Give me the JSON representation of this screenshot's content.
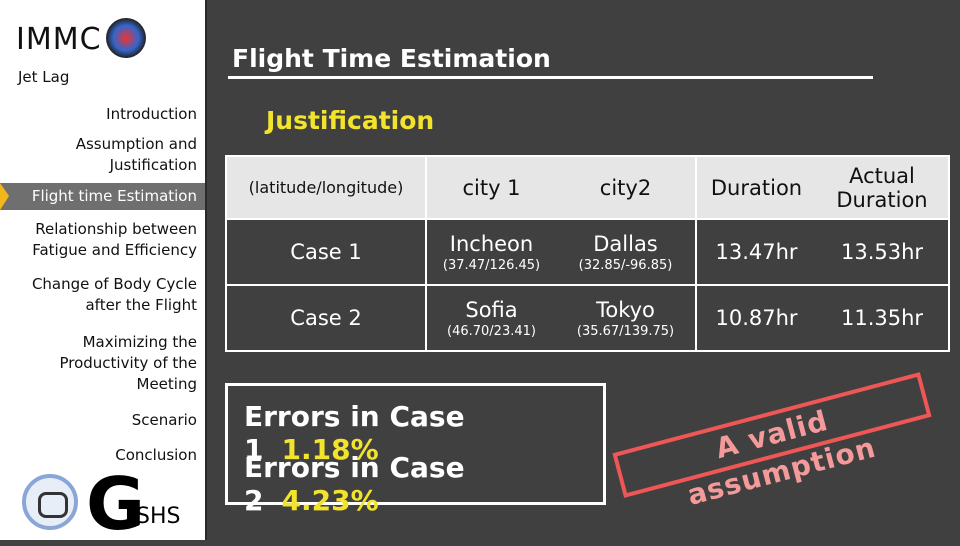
{
  "sidebar": {
    "brand": "IMMC",
    "subtitle": "Jet Lag",
    "items": [
      {
        "label": "Introduction"
      },
      {
        "label": "Assumption and Justification"
      },
      {
        "label": "Flight time Estimation",
        "active": true
      },
      {
        "label": "Relationship between Fatigue and Efficiency"
      },
      {
        "label": "Change of Body Cycle after the Flight"
      },
      {
        "label": "Maximizing the Productivity of the Meeting"
      },
      {
        "label": "Scenario"
      },
      {
        "label": "Conclusion"
      }
    ],
    "footer_logo": {
      "big": "G",
      "small": "SHS"
    },
    "active_color": "#6f6f6f",
    "marker_color": "#f3b71b"
  },
  "main": {
    "title": "Flight Time Estimation",
    "section": "Justification",
    "table": {
      "headers": [
        "(latitude/longitude)",
        "city 1",
        "city2",
        "Duration",
        "Actual Duration"
      ],
      "rows": [
        {
          "case": "Case 1",
          "city1": "Incheon",
          "city1_coord": "(37.47/126.45)",
          "city2": "Dallas",
          "city2_coord": "(32.85/-96.85)",
          "duration": "13.47hr",
          "actual": "13.53hr"
        },
        {
          "case": "Case 2",
          "city1": "Sofia",
          "city1_coord": "(46.70/23.41)",
          "city2": "Tokyo",
          "city2_coord": "(35.67/139.75)",
          "duration": "10.87hr",
          "actual": "11.35hr"
        }
      ]
    },
    "errors": [
      {
        "label": "Errors in Case 1",
        "value": "1.18%"
      },
      {
        "label": "Errors in Case 2",
        "value": "4.23%"
      }
    ],
    "stamp": "A valid assumption",
    "accent": "#f2e32c",
    "stamp_color": "#ef5656"
  }
}
